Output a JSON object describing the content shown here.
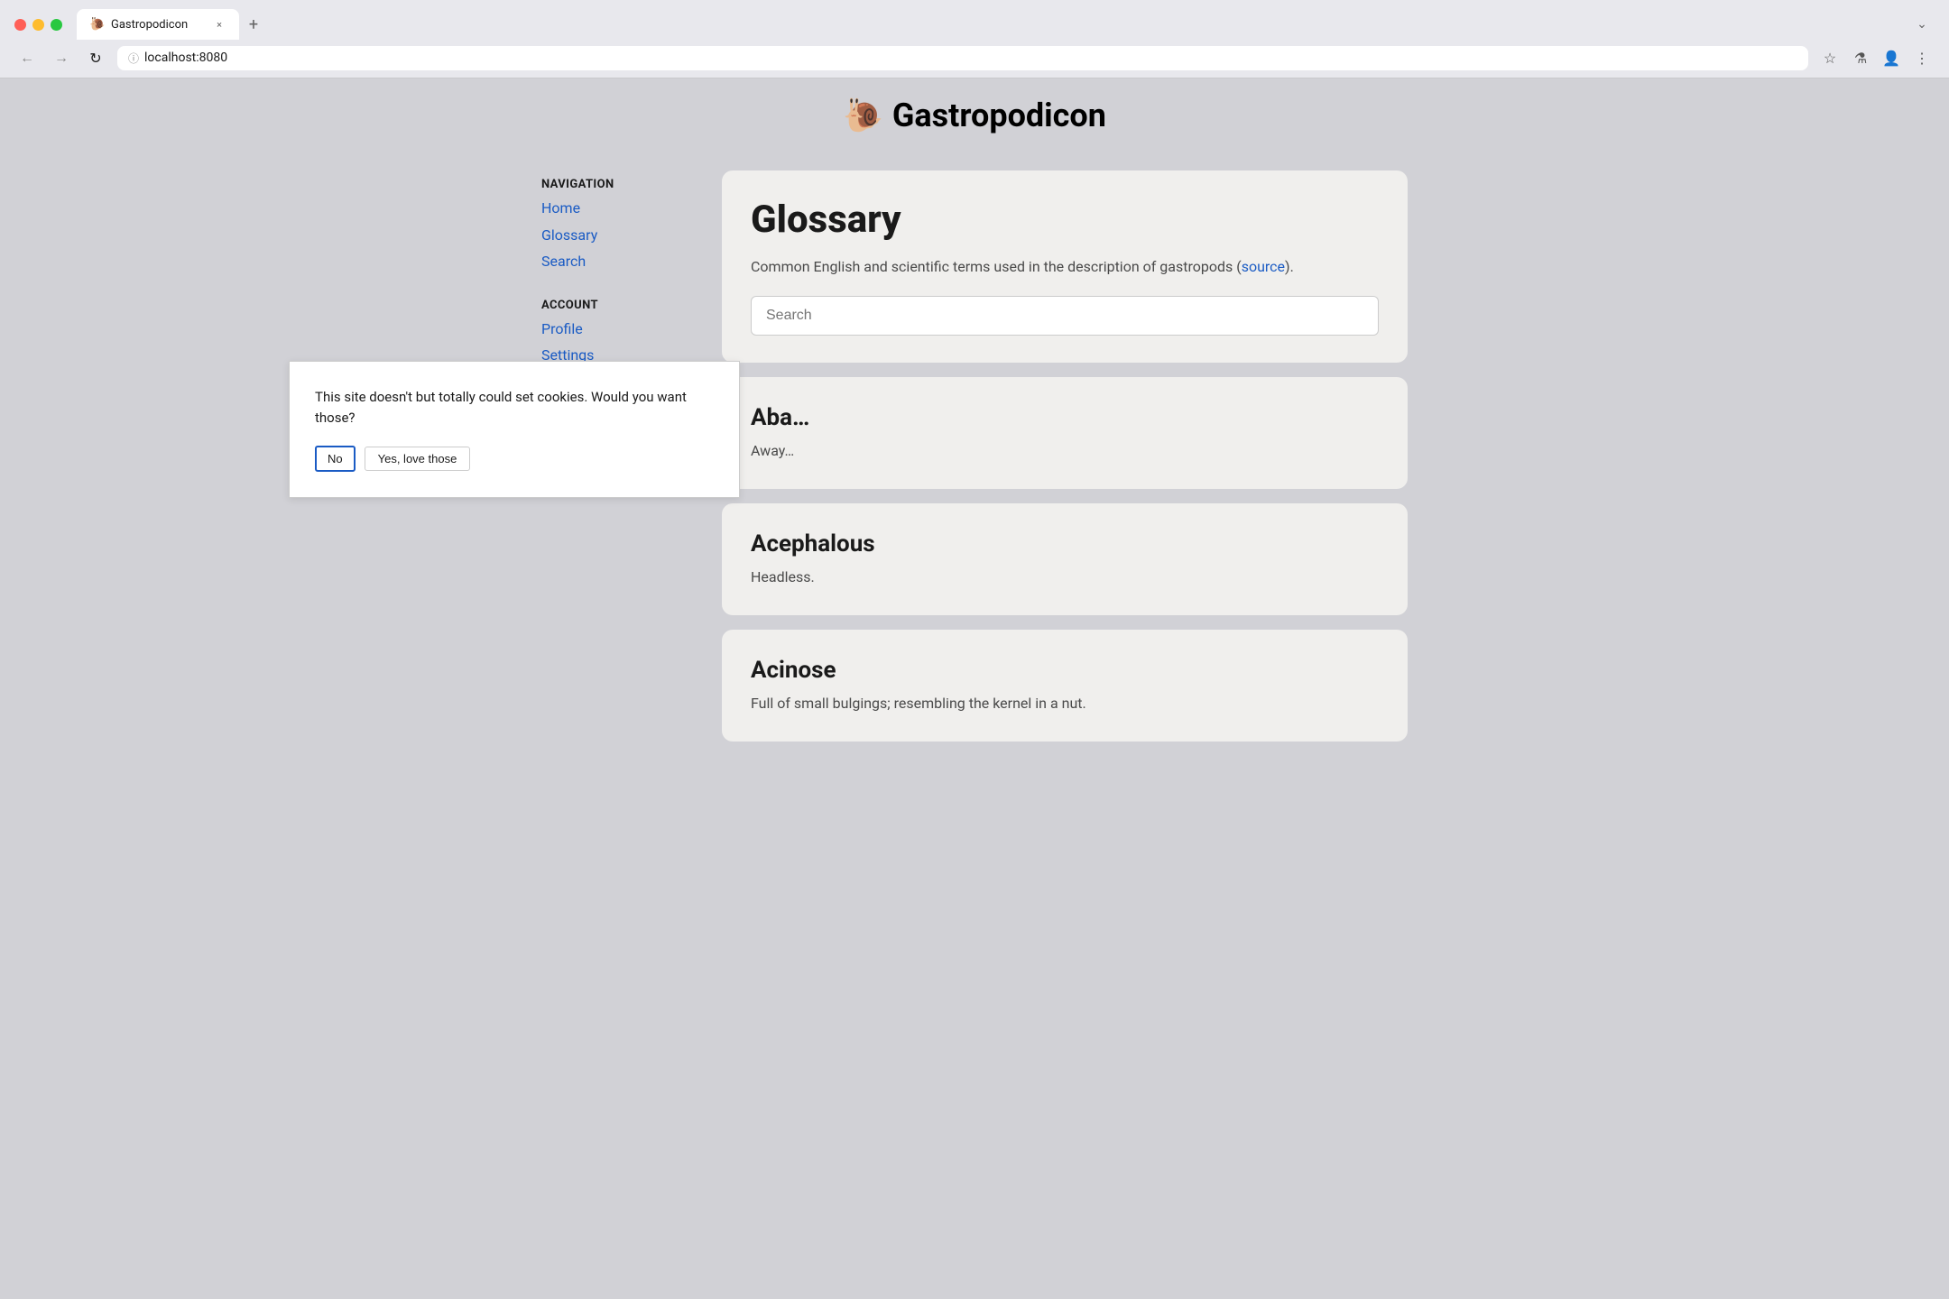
{
  "browser": {
    "tab_favicon": "🐌",
    "tab_title": "Gastropodicon",
    "tab_close_label": "×",
    "tab_new_label": "+",
    "tab_dropdown_label": "⌄",
    "back_label": "←",
    "forward_label": "→",
    "reload_label": "↻",
    "address_info_label": "ⓘ",
    "address_url": "localhost:8080",
    "bookmark_label": "☆",
    "experiments_label": "⚗",
    "profile_label": "👤",
    "menu_label": "⋮"
  },
  "site": {
    "snail_icon": "🐌",
    "title": "Gastropodicon"
  },
  "sidebar": {
    "nav_label": "NAVIGATION",
    "nav_links": [
      {
        "text": "Home",
        "href": "#"
      },
      {
        "text": "Glossary",
        "href": "#"
      },
      {
        "text": "Search",
        "href": "#"
      }
    ],
    "account_label": "ACCOUNT",
    "account_links": [
      {
        "text": "Profile",
        "href": "#"
      },
      {
        "text": "Settings",
        "href": "#"
      }
    ]
  },
  "main": {
    "page_title": "Glossary",
    "description_text": "Common English and scientific terms used in the description of gastropods (",
    "source_link_text": "source",
    "description_end": ").",
    "search_placeholder": "Search",
    "glossary_entries": [
      {
        "term": "Aba…",
        "definition": "Away…"
      },
      {
        "term": "Acephalous",
        "definition": "Headless."
      },
      {
        "term": "Acinose",
        "definition": "Full of small bulgings; resembling the kernel in a nut."
      }
    ]
  },
  "cookie_dialog": {
    "message": "This site doesn't but totally could set cookies. Would you want those?",
    "btn_no_label": "No",
    "btn_yes_label": "Yes, love those"
  }
}
